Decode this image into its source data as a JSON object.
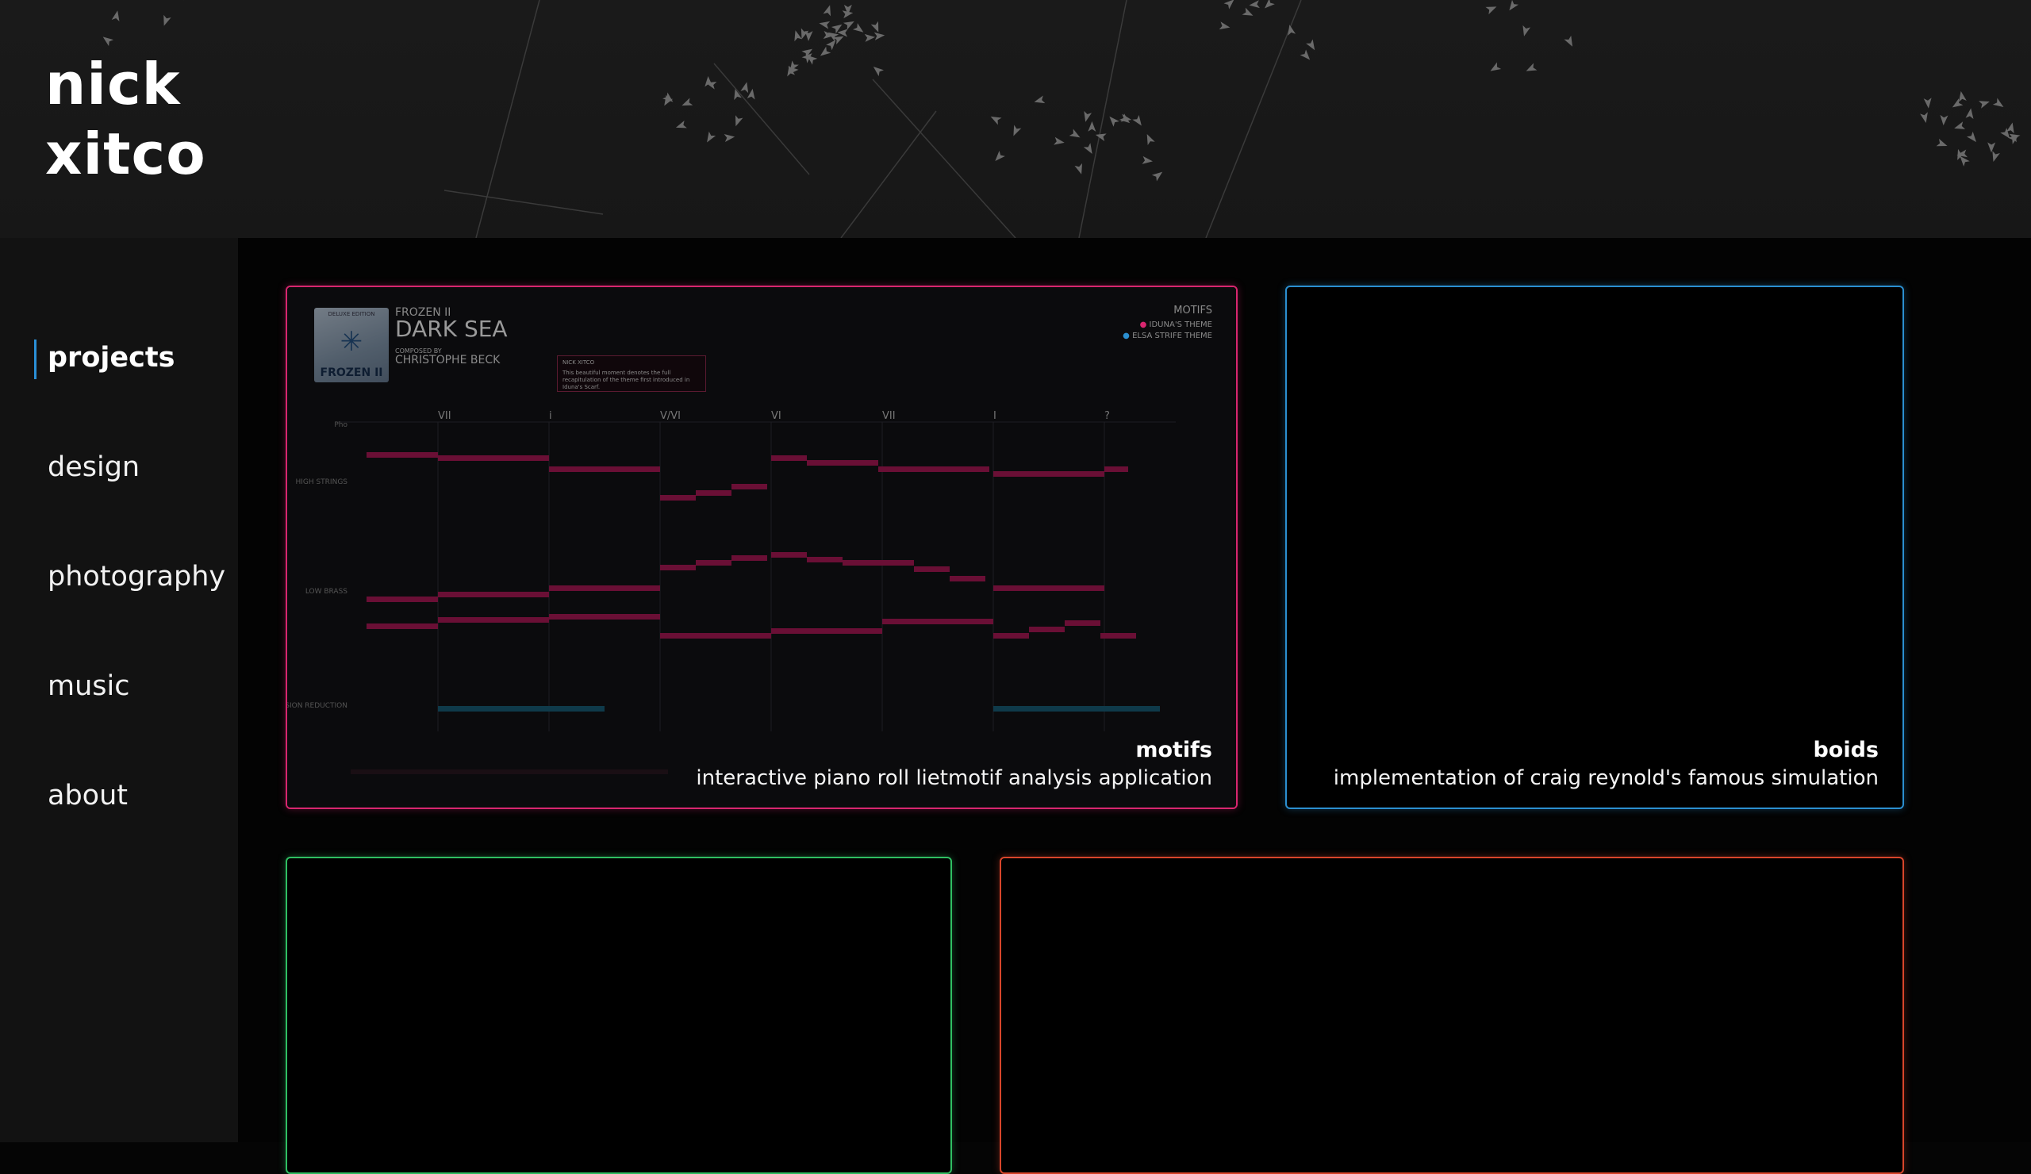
{
  "site": {
    "name_line1": "nick",
    "name_line2": "xitco"
  },
  "nav": {
    "items": [
      {
        "label": "projects",
        "active": true
      },
      {
        "label": "design",
        "active": false
      },
      {
        "label": "photography",
        "active": false
      },
      {
        "label": "music",
        "active": false
      },
      {
        "label": "about",
        "active": false
      }
    ]
  },
  "colors": {
    "background": "#050505",
    "sidebar": "#121212",
    "accent_nav": "#2a8fd6",
    "card_pink": "#d8266f",
    "card_blue": "#2b8fd0",
    "card_green": "#2fbf62",
    "card_orange": "#d8452a"
  },
  "cards": [
    {
      "title": "motifs",
      "description": "interactive piano roll lietmotif analysis application",
      "preview": {
        "album_top": "DELUXE EDITION",
        "album_bottom": "FROZEN II",
        "subtitle": "FROZEN II",
        "song": "DARK SEA",
        "composed_by": "COMPOSED BY",
        "composer": "CHRISTOPHE BECK",
        "motifs_heading": "MOTIFS",
        "legend": [
          "IDUNA'S THEME",
          "ELSA STRIFE THEME"
        ],
        "annotation_author": "NICK XITCO",
        "annotation_text": "This beautiful moment denotes the full recapitulation of the theme first introduced in Iduna's Scarf.",
        "chords": [
          "VII",
          "i",
          "V/VI",
          "VI",
          "VII",
          "I",
          "?"
        ],
        "rows": [
          "Pho",
          "HIGH STRINGS",
          "LOW BRASS",
          "PERCUSSION REDUCTION"
        ]
      }
    },
    {
      "title": "boids",
      "description": "implementation of craig reynold's famous simulation"
    },
    {
      "title": "",
      "description": ""
    },
    {
      "title": "",
      "description": ""
    }
  ]
}
